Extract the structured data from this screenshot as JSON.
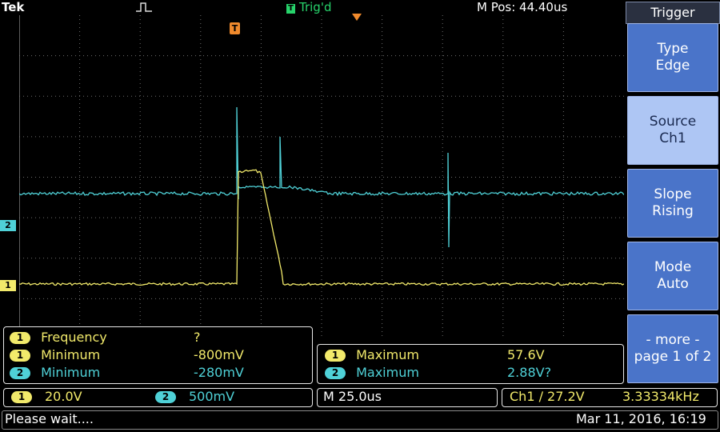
{
  "header": {
    "brand": "Tek",
    "trigger_status_glyph": "T",
    "trigger_status": "Trig'd",
    "m_pos": "M Pos: 44.40us"
  },
  "trigger_marker": "T",
  "channel_markers": {
    "ch1": "1",
    "ch2": "2"
  },
  "side_menu": {
    "title": "Trigger",
    "buttons": [
      {
        "label": "Type\nEdge",
        "active": false
      },
      {
        "label": "Source\nCh1",
        "active": true
      },
      {
        "label": "Slope\nRising",
        "active": false
      },
      {
        "label": "Mode\nAuto",
        "active": false
      },
      {
        "label": "- more -\npage 1 of 2",
        "active": false
      }
    ]
  },
  "measurements_left": [
    {
      "ch": "1",
      "name": "Frequency",
      "value": "?",
      "color": "#f2ea6b"
    },
    {
      "ch": "1",
      "name": "Minimum",
      "value": "-800mV",
      "color": "#f2ea6b"
    },
    {
      "ch": "2",
      "name": "Minimum",
      "value": "-280mV",
      "color": "#4fd1d7"
    }
  ],
  "measurements_right": [
    {
      "ch": "1",
      "name": "Maximum",
      "value": "57.6V",
      "color": "#f2ea6b"
    },
    {
      "ch": "2",
      "name": "Maximum",
      "value": "2.88V?",
      "color": "#4fd1d7"
    }
  ],
  "status": {
    "ch1_label": "1",
    "ch1_scale": "20.0V",
    "ch2_label": "2",
    "ch2_scale": "500mV",
    "timebase": "M 25.0us",
    "trigger_info": "Ch1 ∕ 27.2V",
    "frequency": "3.33334kHz"
  },
  "footer": {
    "message": "Please wait....",
    "datetime": "Mar 11, 2016, 16:19"
  },
  "colors": {
    "ch1": "#f2ea6b",
    "ch2": "#4fd1d7",
    "trigger": "#f08a2c",
    "status_green": "#27d36b",
    "menu": "#4a74c9"
  }
}
